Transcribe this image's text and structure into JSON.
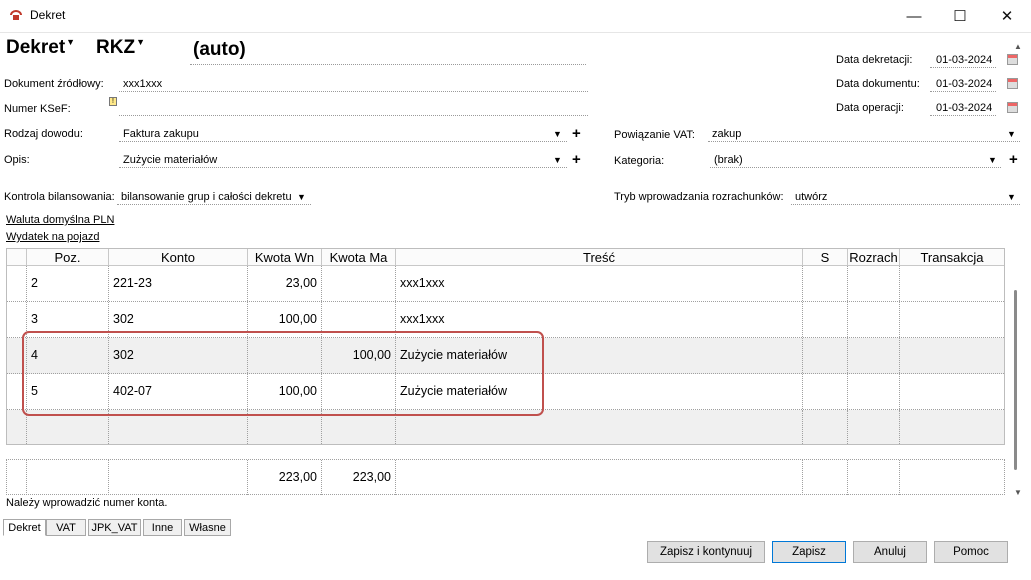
{
  "window": {
    "title": "Dekret"
  },
  "header": {
    "doc_type": "Dekret",
    "register": "RKZ",
    "number": "(auto)"
  },
  "fields": {
    "source_doc_label": "Dokument źródłowy:",
    "source_doc_value": "xxx1xxx",
    "ksef_label": "Numer KSeF:",
    "ksef_value": "",
    "proof_label": "Rodzaj dowodu:",
    "proof_value": "Faktura zakupu",
    "desc_label": "Opis:",
    "desc_value": "Zużycie materiałów",
    "balance_label": "Kontrola bilansowania:",
    "balance_value": "bilansowanie grup i całości dekretu",
    "vat_link_label": "Powiązanie VAT:",
    "vat_link_value": "zakup",
    "category_label": "Kategoria:",
    "category_value": "(brak)",
    "settle_label": "Tryb wprowadzania rozrachunków:",
    "settle_value": "utwórz"
  },
  "dates": {
    "posting_label": "Data dekretacji:",
    "posting_value": "01-03-2024",
    "document_label": "Data dokumentu:",
    "document_value": "01-03-2024",
    "operation_label": "Data operacji:",
    "operation_value": "01-03-2024"
  },
  "links": {
    "currency": "Waluta domyślna PLN",
    "vehicle": "Wydatek na pojazd"
  },
  "grid": {
    "columns": [
      "Poz.",
      "Konto",
      "Kwota Wn",
      "Kwota Ma",
      "Treść",
      "S",
      "Rozrach",
      "Transakcja"
    ],
    "rows": [
      {
        "poz": "2",
        "konto": "221-23",
        "wn": "23,00",
        "ma": "",
        "tresc": "xxx1xxx"
      },
      {
        "poz": "3",
        "konto": "302",
        "wn": "100,00",
        "ma": "",
        "tresc": "xxx1xxx"
      },
      {
        "poz": "4",
        "konto": "302",
        "wn": "",
        "ma": "100,00",
        "tresc": "Zużycie materiałów"
      },
      {
        "poz": "5",
        "konto": "402-07",
        "wn": "100,00",
        "ma": "",
        "tresc": "Zużycie materiałów"
      }
    ],
    "totals": {
      "wn": "223,00",
      "ma": "223,00"
    }
  },
  "status": "Należy wprowadzić numer konta.",
  "tabs": [
    "Dekret",
    "VAT",
    "JPK_VAT",
    "Inne",
    "Własne"
  ],
  "buttons": {
    "save_continue": "Zapisz i kontynuuj",
    "save": "Zapisz",
    "cancel": "Anuluj",
    "help": "Pomoc"
  },
  "colors": {
    "highlight": "#c0504d",
    "selected_row": "#f0f0f0"
  }
}
